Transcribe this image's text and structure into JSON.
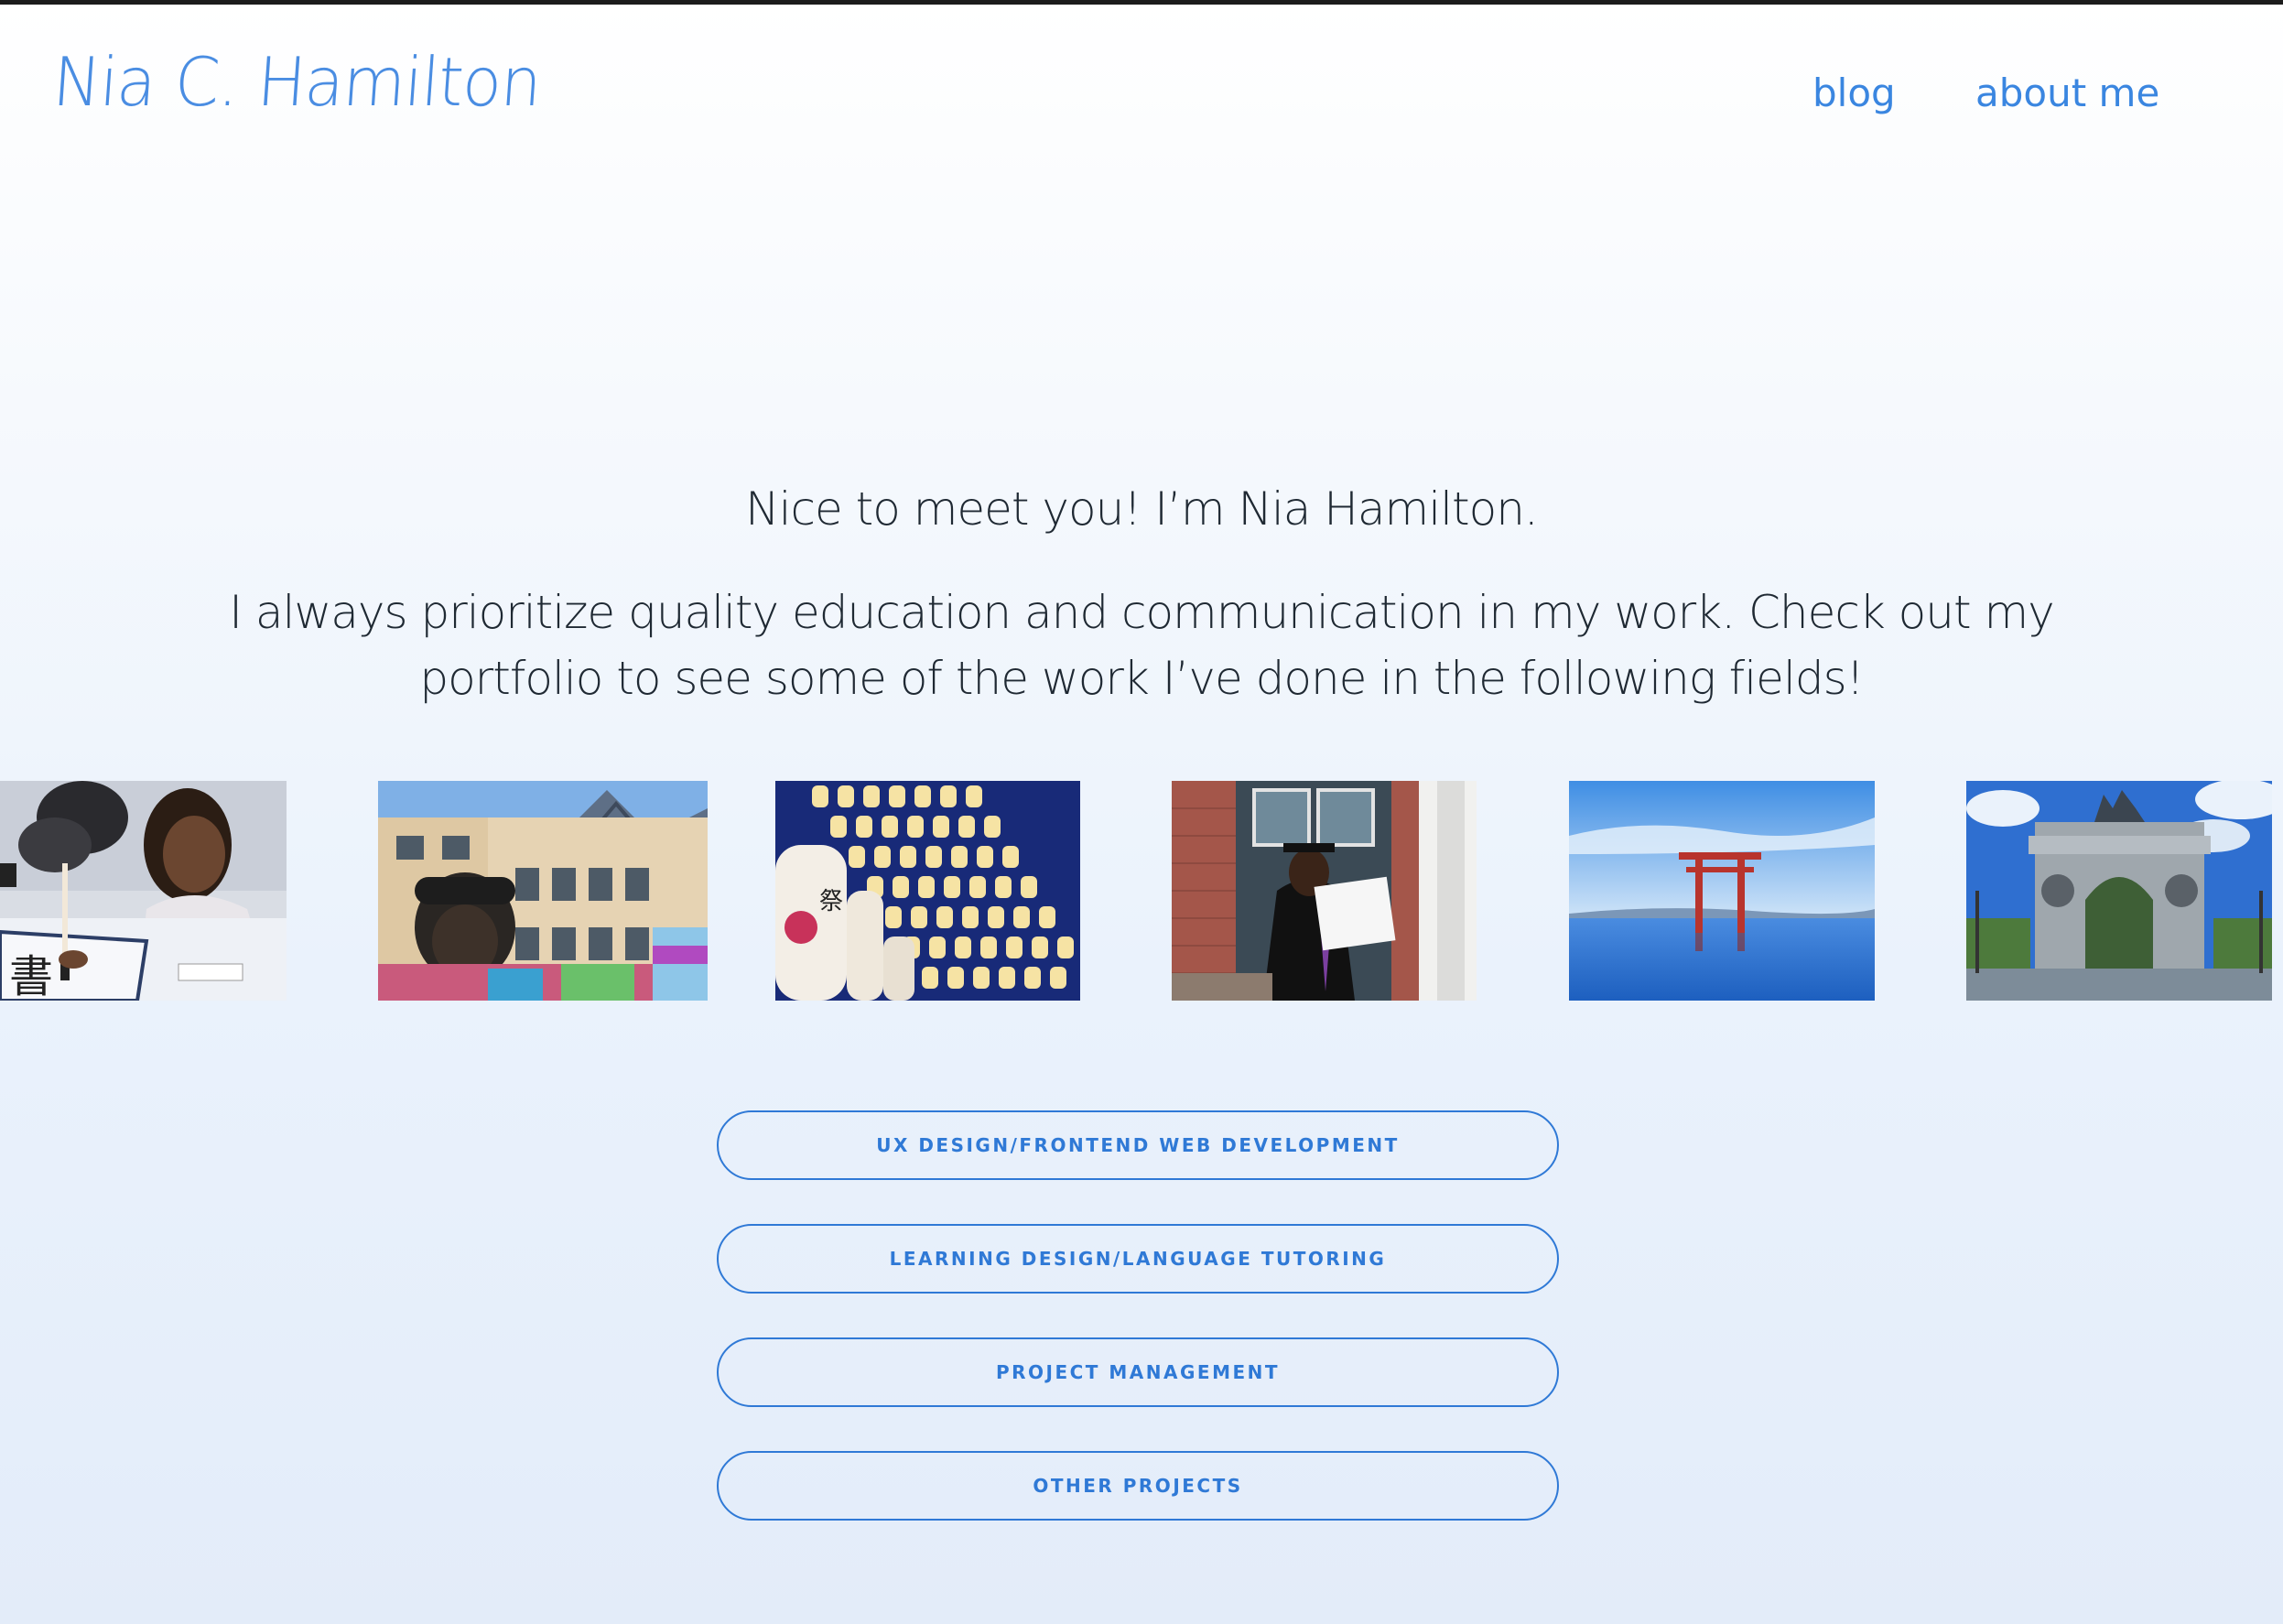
{
  "header": {
    "logo_text": "Nia C. Hamilton",
    "nav": {
      "blog": "blog",
      "about": "about me"
    }
  },
  "intro": {
    "greeting": "Nice to meet you! I’m Nia Hamilton.",
    "line1": "I always prioritize quality education and communication in my work. Check out my",
    "line2": "portfolio to see some of the work I’ve done in the following fields!"
  },
  "gallery": {
    "photos": [
      "calligraphy-photo",
      "street-mural-photo",
      "lanterns-photo",
      "graduation-photo",
      "lake-torii-photo",
      "memorial-arch-photo"
    ]
  },
  "fields": [
    "UX DESIGN/FRONTEND WEB DEVELOPMENT",
    "LEARNING DESIGN/LANGUAGE TUTORING",
    "PROJECT MANAGEMENT",
    "OTHER PROJECTS"
  ],
  "colors": {
    "accent": "#2f79d6",
    "logo": "#4a8de2",
    "text": "#1f2933"
  }
}
